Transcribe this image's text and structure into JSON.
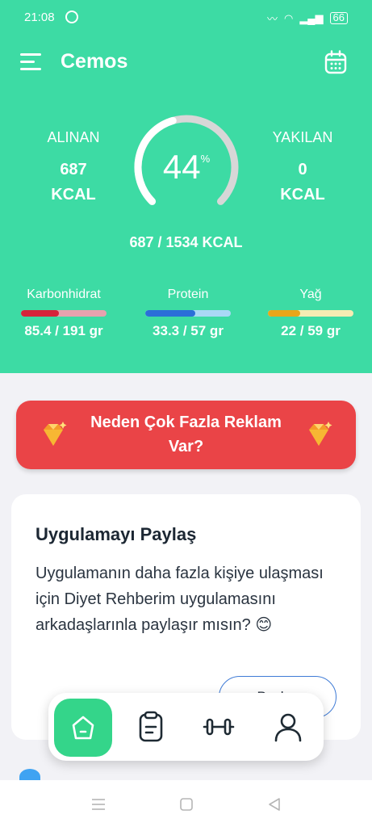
{
  "status_bar": {
    "time": "21:08",
    "battery": "66"
  },
  "app": {
    "title": "Cemos"
  },
  "summary": {
    "taken": {
      "label": "ALINAN",
      "value": "687",
      "unit": "KCAL"
    },
    "burned": {
      "label": "YAKILAN",
      "value": "0",
      "unit": "KCAL"
    },
    "ring": {
      "percent": "44",
      "percent_sign": "%",
      "fraction": 0.44
    },
    "total": "687 / 1534 KCAL"
  },
  "macros": [
    {
      "name": "Karbonhidrat",
      "amount": "85.4 / 191 gr",
      "fraction": 0.447,
      "color": "#d5243a",
      "track": "#e7a2ae"
    },
    {
      "name": "Protein",
      "amount": "33.3 / 57 gr",
      "fraction": 0.584,
      "color": "#2b6fd8",
      "track": "#a9d8f6"
    },
    {
      "name": "Yağ",
      "amount": "22 / 59 gr",
      "fraction": 0.373,
      "color": "#e9a619",
      "track": "#f5ecb3"
    }
  ],
  "ad_banner": {
    "text": "Neden Çok Fazla Reklam Var?"
  },
  "share_card": {
    "title": "Uygulamayı Paylaş",
    "body": "Uygulamanın daha fazla kişiye ulaşması için Diyet Rehberim uygulamasını arkadaşlarınla paylaşır mısın? 😊",
    "button": "Paylaş"
  },
  "bottom_nav": {
    "items": [
      {
        "icon": "home-icon",
        "active": true
      },
      {
        "icon": "clipboard-icon",
        "active": false
      },
      {
        "icon": "dumbbell-icon",
        "active": false
      },
      {
        "icon": "profile-icon",
        "active": false
      }
    ]
  },
  "colors": {
    "header_bg": "#3ddba4",
    "accent_green": "#34d58a",
    "ad_red": "#ea4447",
    "page_bg": "#f2f2f6"
  }
}
